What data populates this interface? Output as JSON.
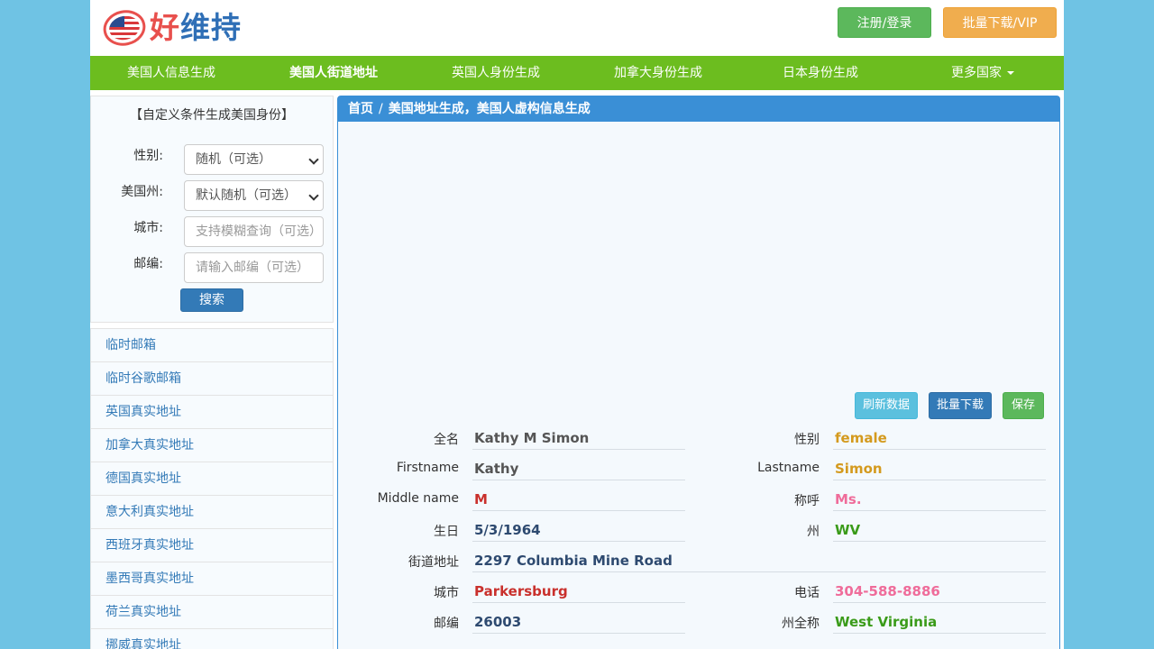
{
  "header": {
    "logo_text_part1": "好",
    "logo_text_part2": "维持",
    "register_label": "注册/登录",
    "vip_label": "批量下载/VIP"
  },
  "nav": {
    "items": [
      "美国人信息生成",
      "美国人街道地址",
      "英国人身份生成",
      "加拿大身份生成",
      "日本身份生成",
      "更多国家"
    ],
    "active_index": 1
  },
  "search": {
    "title": "【自定义条件生成美国身份】",
    "gender_label": "性别:",
    "gender_value": "随机（可选）",
    "state_label": "美国州:",
    "state_value": "默认随机（可选）",
    "city_label": "城市:",
    "city_placeholder": "支持模糊查询（可选）",
    "zip_label": "邮编:",
    "zip_placeholder": "请输入邮编（可选）",
    "search_button": "搜索"
  },
  "links": [
    "临时邮箱",
    "临时谷歌邮箱",
    "英国真实地址",
    "加拿大真实地址",
    "德国真实地址",
    "意大利真实地址",
    "西班牙真实地址",
    "墨西哥真实地址",
    "荷兰真实地址",
    "挪威真实地址"
  ],
  "breadcrumb": {
    "home": "首页",
    "separator": "/",
    "current": "美国地址生成，美国人虚构信息生成"
  },
  "actions": {
    "refresh": "刷新数据",
    "batch": "批量下载",
    "save": "保存"
  },
  "fields": {
    "fullname_label": "全名",
    "fullname": "Kathy M Simon",
    "gender_label": "性别",
    "gender": "female",
    "firstname_label": "Firstname",
    "firstname": "Kathy",
    "lastname_label": "Lastname",
    "lastname": "Simon",
    "middlename_label": "Middle name",
    "middlename": "M",
    "title_label": "称呼",
    "title": "Ms.",
    "birthday_label": "生日",
    "birthday": "5/3/1964",
    "state_label": "州",
    "state": "WV",
    "street_label": "街道地址",
    "street": "2297 Columbia Mine Road",
    "city_label": "城市",
    "city": "Parkersburg",
    "phone_label": "电话",
    "phone": "304-588-8886",
    "zip_label": "邮编",
    "zip": "26003",
    "state_full_label": "州全称",
    "state_full": "West Virginia"
  },
  "colors": {
    "nav_bg": "#6cbd1f",
    "panel_header": "#3a8fd6",
    "page_bg": "#6fc3e4"
  }
}
